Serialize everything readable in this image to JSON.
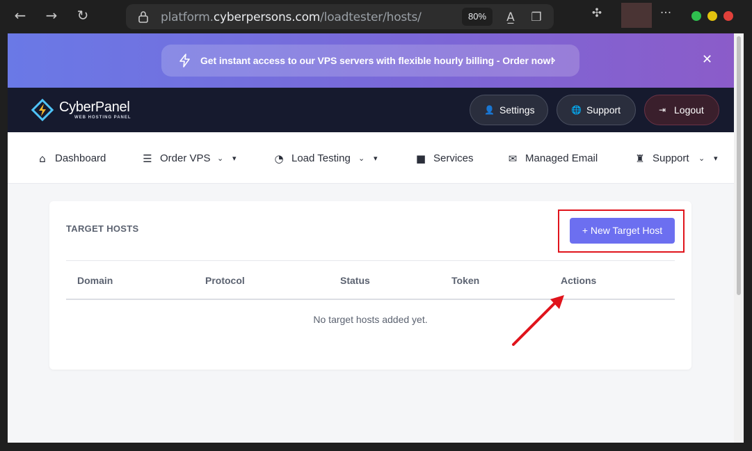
{
  "browser": {
    "url_prefix": "platform.",
    "url_host": "cyberpersons.com",
    "url_path": "/loadtester/hosts/",
    "zoom": "80%"
  },
  "promo": {
    "text": "Get instant access to our VPS servers with flexible hourly billing - Order now!"
  },
  "header": {
    "logo_text": "CyberPanel",
    "logo_sub": "WEB HOSTING PANEL",
    "buttons": [
      {
        "label": "Settings",
        "icon": "user-gear-icon"
      },
      {
        "label": "Support",
        "icon": "globe-icon"
      },
      {
        "label": "Logout",
        "icon": "logout-icon"
      }
    ]
  },
  "menu": {
    "items": [
      {
        "label": "Dashboard",
        "icon": "home-icon"
      },
      {
        "label": "Order VPS",
        "icon": "server-icon"
      },
      {
        "label": "Load Testing",
        "icon": "gauge-icon"
      },
      {
        "label": "Services",
        "icon": "briefcase-icon"
      },
      {
        "label": "Managed Email",
        "icon": "envelope-icon"
      },
      {
        "label": "Support",
        "icon": "support-icon"
      }
    ]
  },
  "card": {
    "title": "TARGET HOSTS",
    "new_button": "+ New Target Host",
    "columns": [
      "Domain",
      "Protocol",
      "Status",
      "Token",
      "Actions"
    ],
    "empty_message": "No target hosts added yet."
  },
  "colors": {
    "accent": "#6c6ff0",
    "header_bg": "#161a2e",
    "highlight": "#e0141c"
  }
}
